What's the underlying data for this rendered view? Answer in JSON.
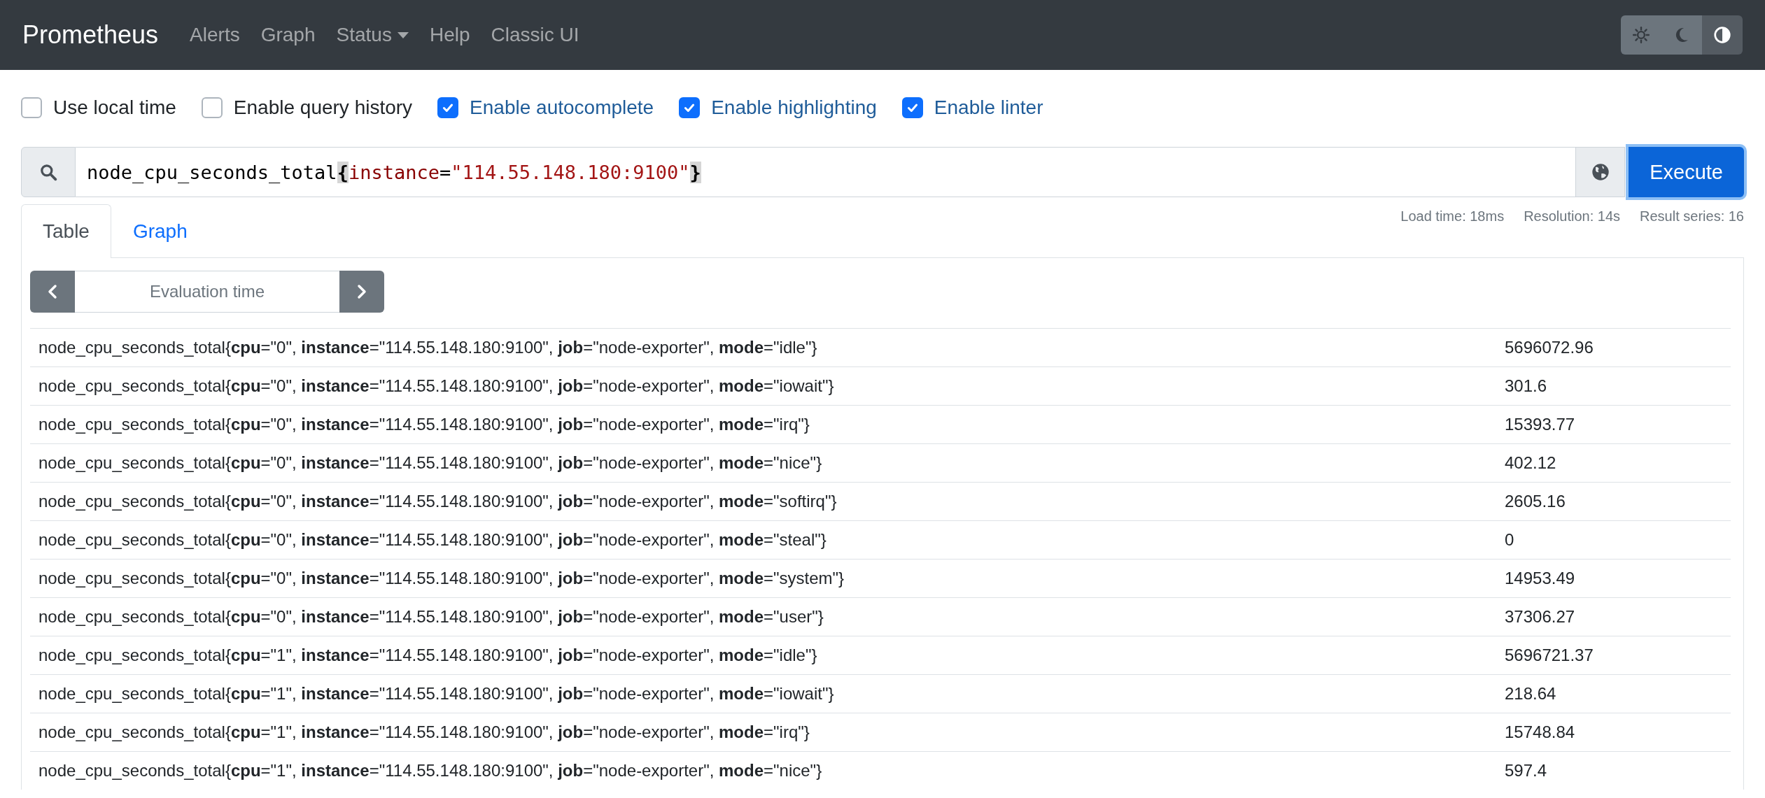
{
  "navbar": {
    "brand": "Prometheus",
    "links": [
      {
        "label": "Alerts",
        "dropdown": false
      },
      {
        "label": "Graph",
        "dropdown": false
      },
      {
        "label": "Status",
        "dropdown": true
      },
      {
        "label": "Help",
        "dropdown": false
      },
      {
        "label": "Classic UI",
        "dropdown": false
      }
    ],
    "theme_buttons": [
      {
        "kind": "light",
        "selected": false
      },
      {
        "kind": "dark",
        "selected": false
      },
      {
        "kind": "auto",
        "selected": true
      }
    ]
  },
  "options": [
    {
      "label": "Use local time",
      "checked": false
    },
    {
      "label": "Enable query history",
      "checked": false
    },
    {
      "label": "Enable autocomplete",
      "checked": true
    },
    {
      "label": "Enable highlighting",
      "checked": true
    },
    {
      "label": "Enable linter",
      "checked": true
    }
  ],
  "query": {
    "tokens": [
      {
        "kind": "metric",
        "text": "node_cpu_seconds_total"
      },
      {
        "kind": "brace",
        "text": "{"
      },
      {
        "kind": "label",
        "text": "instance"
      },
      {
        "kind": "operator",
        "text": "="
      },
      {
        "kind": "string",
        "text": "\"114.55.148.180:9100\""
      },
      {
        "kind": "brace",
        "text": "}"
      }
    ],
    "execute_label": "Execute"
  },
  "stats": [
    "Load time: 18ms",
    "Resolution: 14s",
    "Result series: 16"
  ],
  "tabs": [
    {
      "label": "Table",
      "selected": true
    },
    {
      "label": "Graph",
      "selected": false
    }
  ],
  "evaluation_time": {
    "placeholder": "Evaluation time"
  },
  "rows": [
    {
      "series": "node_cpu_seconds_total{**cpu**=\"0\", **instance**=\"114.55.148.180:9100\", **job**=\"node-exporter\", **mode**=\"idle\"}",
      "value": "5696072.96"
    },
    {
      "series": "node_cpu_seconds_total{**cpu**=\"0\", **instance**=\"114.55.148.180:9100\", **job**=\"node-exporter\", **mode**=\"iowait\"}",
      "value": "301.6"
    },
    {
      "series": "node_cpu_seconds_total{**cpu**=\"0\", **instance**=\"114.55.148.180:9100\", **job**=\"node-exporter\", **mode**=\"irq\"}",
      "value": "15393.77"
    },
    {
      "series": "node_cpu_seconds_total{**cpu**=\"0\", **instance**=\"114.55.148.180:9100\", **job**=\"node-exporter\", **mode**=\"nice\"}",
      "value": "402.12"
    },
    {
      "series": "node_cpu_seconds_total{**cpu**=\"0\", **instance**=\"114.55.148.180:9100\", **job**=\"node-exporter\", **mode**=\"softirq\"}",
      "value": "2605.16"
    },
    {
      "series": "node_cpu_seconds_total{**cpu**=\"0\", **instance**=\"114.55.148.180:9100\", **job**=\"node-exporter\", **mode**=\"steal\"}",
      "value": "0"
    },
    {
      "series": "node_cpu_seconds_total{**cpu**=\"0\", **instance**=\"114.55.148.180:9100\", **job**=\"node-exporter\", **mode**=\"system\"}",
      "value": "14953.49"
    },
    {
      "series": "node_cpu_seconds_total{**cpu**=\"0\", **instance**=\"114.55.148.180:9100\", **job**=\"node-exporter\", **mode**=\"user\"}",
      "value": "37306.27"
    },
    {
      "series": "node_cpu_seconds_total{**cpu**=\"1\", **instance**=\"114.55.148.180:9100\", **job**=\"node-exporter\", **mode**=\"idle\"}",
      "value": "5696721.37"
    },
    {
      "series": "node_cpu_seconds_total{**cpu**=\"1\", **instance**=\"114.55.148.180:9100\", **job**=\"node-exporter\", **mode**=\"iowait\"}",
      "value": "218.64"
    },
    {
      "series": "node_cpu_seconds_total{**cpu**=\"1\", **instance**=\"114.55.148.180:9100\", **job**=\"node-exporter\", **mode**=\"irq\"}",
      "value": "15748.84"
    },
    {
      "series": "node_cpu_seconds_total{**cpu**=\"1\", **instance**=\"114.55.148.180:9100\", **job**=\"node-exporter\", **mode**=\"nice\"}",
      "value": "597.4"
    }
  ]
}
